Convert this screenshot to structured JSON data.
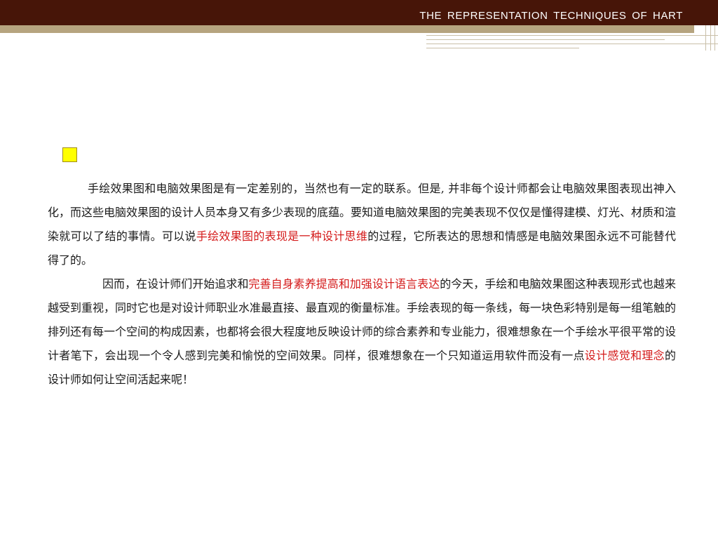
{
  "header": {
    "title": "THE  REPRESENTATION  TECHNIQUES  OF  HART",
    "bar_color": "#471508",
    "band_color": "#b6a47f"
  },
  "bullet": {
    "icon": "square-bullet-icon",
    "color": "#ffff00"
  },
  "highlight_color": "#d41a1a",
  "paragraphs": [
    {
      "s1": "手绘效果图和电脑效果图是有一定差别的，当然也有一定的联系。但是, 并非每个设计师都会让电脑效果图表现出神入化，而这些电脑效果图的设计人员本身又有多少表现的底蕴。要知道电脑效果图的完美表现不仅仅是懂得建模、灯光、材质和渲染就可以了结的事情。可以说",
      "h1": "手绘效果图的表现是一种设计思维",
      "s2": "的过程，它所表达的思想和情感是电脑效果图永远不可能替代得了的。"
    },
    {
      "s1": "因而，在设计师们开始追求和",
      "h1": "完善自身素养提高和加强设计语言表达",
      "s2": "的今天，手绘和电脑效果图这种表现形式也越来越受到重视，同时它也是对设计师职业水准最直接、最直观的衡量标准。手绘表现的每一条线，每一块色彩特别是每一组笔触的排列还有每一个空间的构成因素，也都将会很大程度地反映设计师的综合素养和专业能力，很难想象在一个手绘水平很平常的设计者笔下，会出现一个令人感到完美和愉悦的空间效果。同样，很难想象在一个只知道运用软件而没有一点",
      "h2": "设计感觉和理念",
      "s3": "的设计师如何让空间活起来呢！"
    }
  ]
}
